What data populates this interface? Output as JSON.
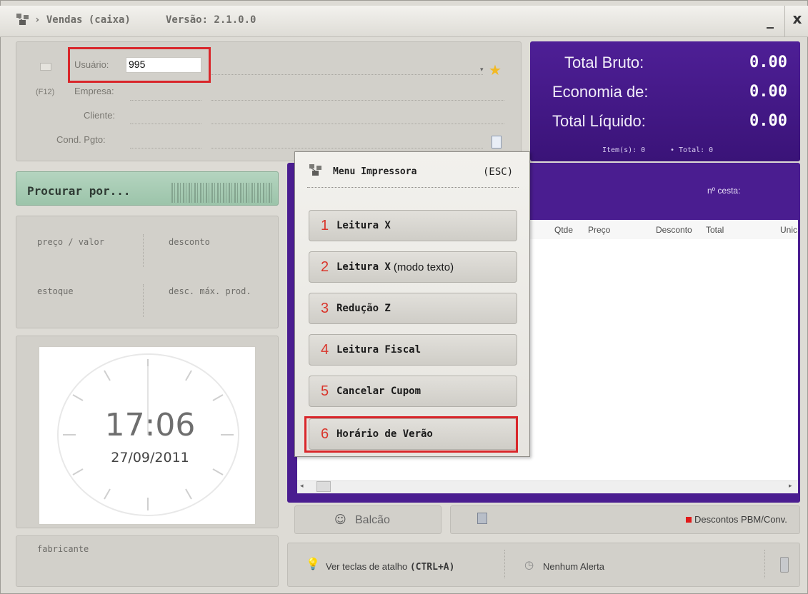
{
  "window": {
    "title": "› Vendas (caixa)",
    "version": "Versão: 2.1.0.0",
    "minimize": "_",
    "close": "x"
  },
  "info": {
    "usuario_label": "Usuário:",
    "usuario_value": "995",
    "f12_label": "(F12)",
    "empresa_label": "Empresa:",
    "cliente_label": "Cliente:",
    "cond_label": "Cond. Pgto:"
  },
  "totals": {
    "bruto_label": "Total Bruto:",
    "bruto_value": "0.00",
    "economia_label": "Economia de:",
    "economia_value": "0.00",
    "liquido_label": "Total Líquido:",
    "liquido_value": "0.00",
    "items_text": "Item(s): 0",
    "total_text": "• Total: 0"
  },
  "search": {
    "label": "Procurar por..."
  },
  "product_info": {
    "preco": "preço / valor",
    "desconto": "desconto",
    "estoque": "estoque",
    "desc_max": "desc. máx. prod."
  },
  "clock": {
    "time": "17:06",
    "date": "27/09/2011"
  },
  "fabricante": "fabricante",
  "grid": {
    "cesta": "nº cesta:",
    "columns": [
      "Qtde",
      "Preço",
      "Desconto",
      "Total",
      "Unic"
    ]
  },
  "buttons": {
    "balcao": "Balcão",
    "pbm": "Descontos PBM/Conv."
  },
  "footer": {
    "atalho_prefix": "Ver teclas de atalho",
    "atalho_key": "(CTRL+A)",
    "alerta": "Nenhum Alerta"
  },
  "menu": {
    "title": "Menu Impressora",
    "esc": "(ESC)",
    "items": [
      {
        "num": "1",
        "label": "Leitura X",
        "extra": ""
      },
      {
        "num": "2",
        "label": "Leitura X",
        "extra": "(modo texto)"
      },
      {
        "num": "3",
        "label": "Redução Z",
        "extra": ""
      },
      {
        "num": "4",
        "label": "Leitura Fiscal",
        "extra": ""
      },
      {
        "num": "5",
        "label": "Cancelar Cupom",
        "extra": ""
      },
      {
        "num": "6",
        "label": "Horário de Verão",
        "extra": ""
      }
    ]
  }
}
